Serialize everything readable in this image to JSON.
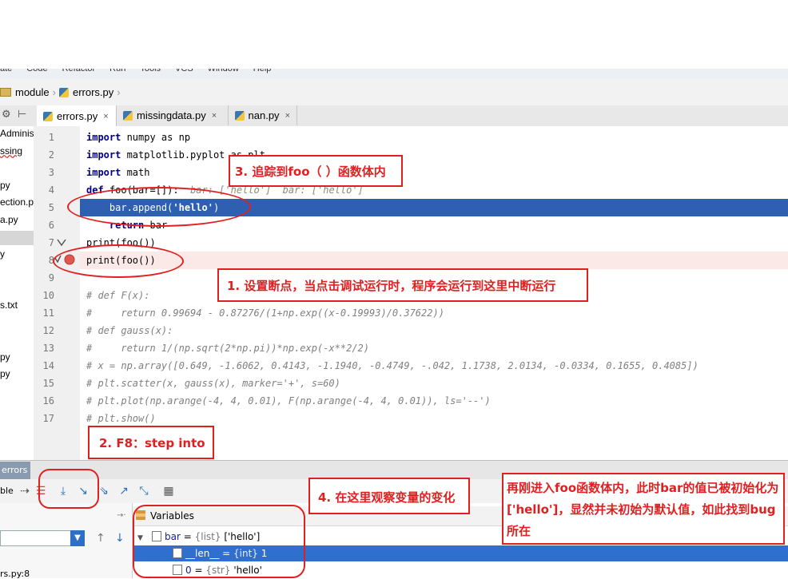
{
  "menu": [
    "ate",
    "Code",
    "Refactor",
    "Run",
    "Tools",
    "VCS",
    "Window",
    "Help"
  ],
  "navbar": {
    "folder": "module",
    "file": "errors.py"
  },
  "tool_glyphs": [
    "⚙",
    "⊢"
  ],
  "tabs": [
    {
      "label": "errors.py",
      "close": "×"
    },
    {
      "label": "missingdata.py",
      "close": "×"
    },
    {
      "label": "nan.py",
      "close": "×"
    }
  ],
  "sidebar": [
    "Administ",
    "ssing",
    "",
    "py",
    "ection.p",
    "a.py",
    "",
    "y",
    "",
    "",
    "s.txt",
    "",
    "",
    "py",
    "py"
  ],
  "lines": [
    {
      "n": "1",
      "segs": [
        {
          "k": "kw",
          "t": "import"
        },
        {
          "t": " numpy as np"
        }
      ]
    },
    {
      "n": "2",
      "segs": [
        {
          "k": "kw",
          "t": "import"
        },
        {
          "t": " matplotlib.pyplot as plt"
        }
      ]
    },
    {
      "n": "3",
      "segs": [
        {
          "k": "kw",
          "t": "import"
        },
        {
          "t": " math"
        }
      ]
    },
    {
      "n": "4",
      "segs": [
        {
          "k": "kw",
          "t": "def"
        },
        {
          "t": " foo(bar=[]):  "
        },
        {
          "k": "inline",
          "t": "bar: ['hello']  bar: ['hello']"
        }
      ]
    },
    {
      "n": "5",
      "segs": [
        {
          "t": "    bar.append("
        },
        {
          "k": "str",
          "t": "'hello'"
        },
        {
          "t": ")"
        }
      ]
    },
    {
      "n": "6",
      "segs": [
        {
          "t": "    "
        },
        {
          "k": "kw",
          "t": "return"
        },
        {
          "t": " bar"
        }
      ]
    },
    {
      "n": "7",
      "segs": [
        {
          "t": "print(foo())"
        }
      ]
    },
    {
      "n": "8",
      "segs": [
        {
          "t": "print(foo())"
        }
      ]
    },
    {
      "n": "9",
      "segs": [
        {
          "t": ""
        }
      ]
    },
    {
      "n": "10",
      "segs": [
        {
          "k": "cm",
          "t": "# def F(x):"
        }
      ]
    },
    {
      "n": "11",
      "segs": [
        {
          "k": "cm",
          "t": "#     return 0.99694 - 0.87276/(1+np.exp((x-0.19993)/0.37622))"
        }
      ]
    },
    {
      "n": "12",
      "segs": [
        {
          "k": "cm",
          "t": "# def gauss(x):"
        }
      ]
    },
    {
      "n": "13",
      "segs": [
        {
          "k": "cm",
          "t": "#     return 1/(np.sqrt(2*np.pi))*np.exp(-x**2/2)"
        }
      ]
    },
    {
      "n": "14",
      "segs": [
        {
          "k": "cm",
          "t": "# x = np.array([0.649, -1.6062, 0.4143, -1.1940, -0.4749, -.042, 1.1738, 2.0134, -0.0334, 0.1655, 0.4085])"
        }
      ]
    },
    {
      "n": "15",
      "segs": [
        {
          "k": "cm",
          "t": "# plt.scatter(x, gauss(x), marker='+', s=60)"
        }
      ]
    },
    {
      "n": "16",
      "segs": [
        {
          "k": "cm",
          "t": "# plt.plot(np.arange(-4, 4, 0.01), F(np.arange(-4, 4, 0.01)), ls='--')"
        }
      ]
    },
    {
      "n": "17",
      "segs": [
        {
          "k": "cm",
          "t": "# plt.show()"
        }
      ]
    }
  ],
  "debug": {
    "tab_label": "errors",
    "frame_label": "ble",
    "frame_bottom": "rs.py:8",
    "variables_title": "Variables",
    "variables": [
      {
        "name": "bar",
        "type": "{list}",
        "value": "['hello']",
        "expand": "▼",
        "indent": 0
      },
      {
        "name": "__len__",
        "type": "{int}",
        "value": "1",
        "expand": "",
        "indent": 1
      },
      {
        "name": "0",
        "type": "{str}",
        "value": "'hello'",
        "expand": "",
        "indent": 1
      }
    ]
  },
  "annotations": {
    "a1": "1. 设置断点，当点击调试运行时，程序会运行到这里中断运行",
    "a2": "2. F8：step into",
    "a3": "3. 追踪到foo（ ）函数体内",
    "a4": "4. 在这里观察变量的变化",
    "a5": "再刚进入foo函数体内，此时bar的值已被初始化为['hello']，显然并未初始为默认值，如此找到bug所在"
  },
  "colors": {
    "exec_line": "#2f5fb0",
    "breakpoint": "#e0574f",
    "annotation": "#e02020",
    "selection": "#2f6fd0"
  }
}
